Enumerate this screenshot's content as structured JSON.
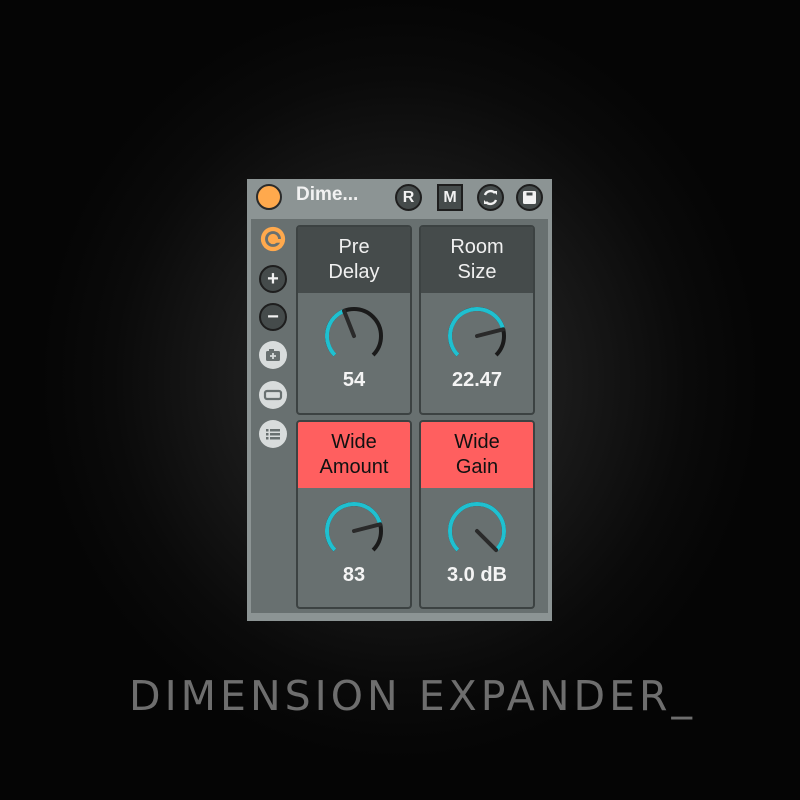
{
  "device": {
    "title": "Dime...",
    "header_buttons": [
      {
        "name": "r-button",
        "label": "R"
      },
      {
        "name": "m-button",
        "label": "M"
      },
      {
        "name": "refresh-icon",
        "label": ""
      },
      {
        "name": "save-icon",
        "label": ""
      }
    ],
    "sidebar_icons": [
      "hot-swap-icon",
      "add-icon",
      "remove-icon",
      "add-preset-icon",
      "minimize-icon",
      "list-icon"
    ]
  },
  "params": [
    {
      "name": "pre-delay",
      "label_line1": "Pre",
      "label_line2": "Delay",
      "value": "54",
      "fraction": 0.42,
      "highlighted": false
    },
    {
      "name": "room-size",
      "label_line1": "Room",
      "label_line2": "Size",
      "value": "22.47",
      "fraction": 0.78,
      "highlighted": false
    },
    {
      "name": "wide-amount",
      "label_line1": "Wide",
      "label_line2": "Amount",
      "value": "83",
      "fraction": 0.78,
      "highlighted": true
    },
    {
      "name": "wide-gain",
      "label_line1": "Wide",
      "label_line2": "Gain",
      "value": "3.0 dB",
      "fraction": 1.0,
      "highlighted": true
    }
  ],
  "colors": {
    "accent_orange": "#ffa94d",
    "knob_active": "#1fc0d0",
    "knob_track": "#1a1a1a",
    "highlight_red": "#ff5f5f"
  },
  "caption": "DIMENSION EXPANDER_"
}
